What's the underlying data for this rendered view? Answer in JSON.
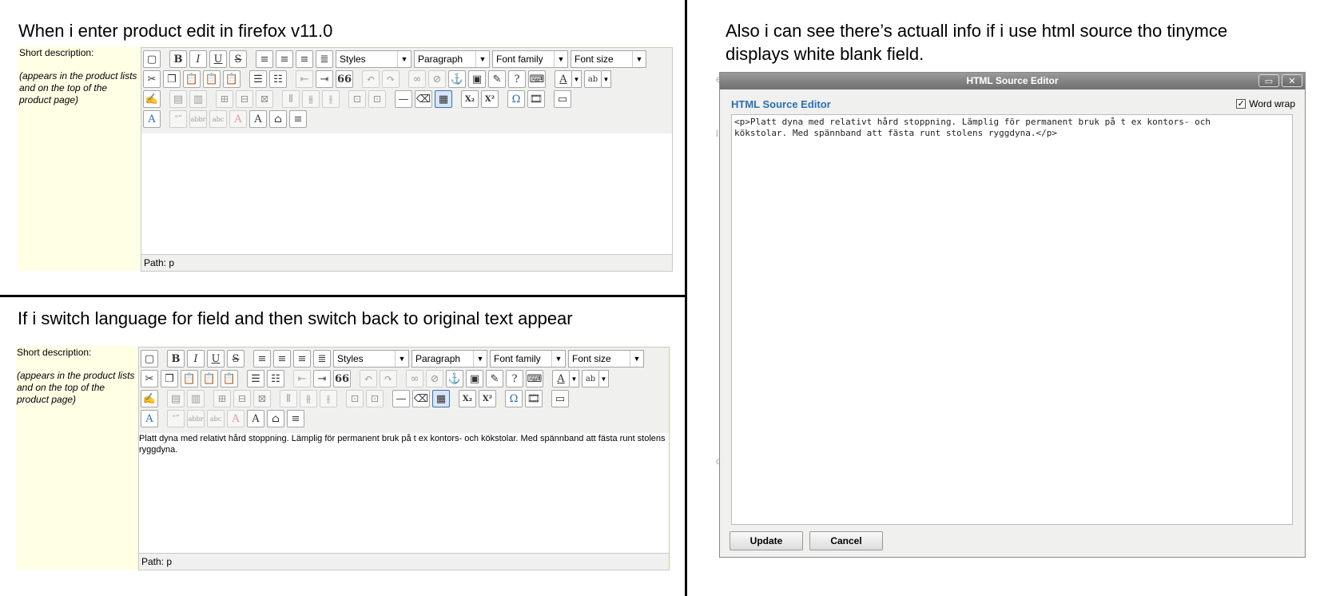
{
  "captions": {
    "top_left": "When i enter product edit in firefox v11.0",
    "bottom_left": "If i switch language for field and then switch back to original text appear",
    "right_line1": "Also i can see there’s actuall info if i use html source tho tinymce",
    "right_line2": "displays white blank field."
  },
  "field": {
    "label": "Short description:",
    "hint_line1": "(appears in the product lists",
    "hint_line2": "and on the top of the",
    "hint_line3": "product page)"
  },
  "toolbar": {
    "styles": "Styles",
    "format": "Paragraph",
    "font_family": "Font family",
    "font_size": "Font size",
    "bold": "B",
    "italic": "I",
    "underline": "U",
    "strike": "S",
    "quote": "66",
    "omega": "Ω",
    "sub": "X₂",
    "sup": "X²"
  },
  "editor_top": {
    "content": "",
    "path": "Path: p"
  },
  "editor_bottom": {
    "content": "Platt dyna med relativt hård stoppning. Lämplig för permanent bruk på t ex kontors- och kökstolar. Med spännband att fästa runt stolens ryggdyna.",
    "path": "Path: p"
  },
  "dialog": {
    "title": "HTML Source Editor",
    "heading": "HTML Source Editor",
    "word_wrap": "Word wrap",
    "word_wrap_checked": true,
    "source": "<p>Platt dyna med relativt hård stoppning. Lämplig för permanent bruk på t ex kontors- och\nkökstolar. Med spännband att fästa runt stolens ryggdyna.</p>",
    "update": "Update",
    "cancel": "Cancel"
  }
}
